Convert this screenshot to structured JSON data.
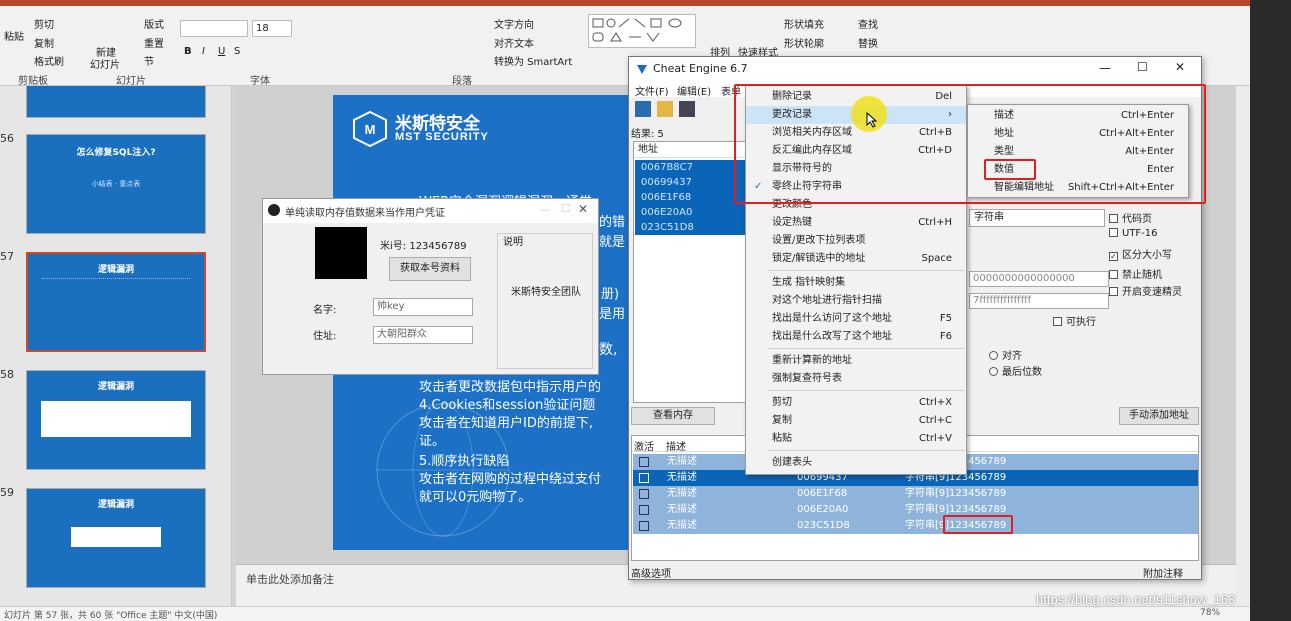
{
  "ribbon": {
    "clipboard": {
      "paste": "粘贴",
      "cut": "剪切",
      "copy": "复制",
      "painter": "格式刷",
      "group": "剪贴板"
    },
    "slides": {
      "new": "新建",
      "new2": "幻灯片",
      "layout": "版式",
      "reset": "重置",
      "section": "节",
      "group": "幻灯片"
    },
    "font": {
      "size": "18",
      "bold": "B",
      "italic": "I",
      "underline": "U",
      "shadow": "S",
      "group": "字体"
    },
    "paragraph": {
      "textdir": "文字方向",
      "align": "对齐文本",
      "smartart": "转换为 SmartArt",
      "group": "段落"
    },
    "drawing": {
      "arrange": "排列",
      "quickstyle": "快速样式",
      "fill": "形状填充",
      "outline": "形状轮廓",
      "effect": "形状效果"
    },
    "editing": {
      "find": "查找",
      "replace": "替换",
      "select": "选择"
    }
  },
  "thumbs": [
    {
      "num": "56",
      "title": "怎么修复SQL注入?",
      "sub": "小结表 · 重点表"
    },
    {
      "num": "57",
      "title": "逻辑漏洞",
      "selected": true
    },
    {
      "num": "58",
      "title": "逻辑漏洞"
    },
    {
      "num": "59",
      "title": "逻辑漏洞"
    }
  ],
  "slide": {
    "brand_cn": "米斯特安全",
    "brand_en": "MST SECURITY",
    "lines": [
      "WEB安全漏洞逻辑漏洞，通常",
      "的错",
      "就是",
      "册)",
      "是用",
      "数,",
      "攻击者更改数据包中指示用户的",
      "4.Cookies和session验证问题",
      "攻击者在知道用户ID的前提下,",
      "证。",
      "5.顺序执行缺陷",
      "攻击者在网购的过程中绕过支付",
      "就可以0元购物了。"
    ]
  },
  "notes": "单击此处添加备注",
  "status": {
    "left": "幻灯片 第 57 张，共 60 张    \"Office 主题\"    中文(中国)",
    "zoom": "78%"
  },
  "watermark": "https://blog.csdn.net/s11show_163",
  "app_window": {
    "title": "单纯读取内存值数据来当作用户凭证",
    "rice_label": "米i号: 123456789",
    "fetch_button": "获取本号资料",
    "desc_title": "说明",
    "desc_text": "米斯特安全团队",
    "name_label": "名字:",
    "name_value": "帅key",
    "addr_label": "住址:",
    "addr_value": "大朝阳群众"
  },
  "ce": {
    "title": "Cheat Engine 6.7",
    "menu": [
      "文件(F)",
      "编辑(E)",
      "表单"
    ],
    "found": "结果: 5",
    "col_addr": "地址",
    "col_cur": "当",
    "addresses": [
      "0067B8C7",
      "00699437",
      "006E1F68",
      "006E20A0",
      "023C51D8"
    ],
    "view_mem": "查看内存",
    "add_manual": "手动添加地址",
    "hex1": "0000000000000000",
    "hex2": "7fffffffffffffff",
    "writable": "可执行",
    "align": "对齐",
    "lastdigit": "最后位数",
    "opt_codepage": "代码页",
    "opt_utf16": "UTF-16",
    "opt_case": "区分大小写",
    "opt_norandom": "禁止随机",
    "opt_speedhack": "开启变速精灵",
    "type_sel": "字符串",
    "rec_headers": [
      "激活",
      "描述"
    ],
    "records": [
      {
        "desc": "无描述",
        "addr": "",
        "type": "",
        "val": "123456789"
      },
      {
        "desc": "无描述",
        "addr": "00699437",
        "type": "字符串[9]",
        "val": "123456789"
      },
      {
        "desc": "无描述",
        "addr": "006E1F68",
        "type": "字符串[9]",
        "val": "123456789"
      },
      {
        "desc": "无描述",
        "addr": "006E20A0",
        "type": "字符串[9]",
        "val": "123456789"
      },
      {
        "desc": "无描述",
        "addr": "023C51D8",
        "type": "字符串[9]",
        "val": "123456789"
      }
    ],
    "advanced": "高级选项",
    "attach": "附加注释"
  },
  "ctx_menu": [
    {
      "label": "删除记录",
      "sc": "Del"
    },
    {
      "label": "更改记录",
      "sc": "",
      "arrow": true,
      "hl": true
    },
    {
      "label": "浏览相关内存区域",
      "sc": "Ctrl+B"
    },
    {
      "label": "反汇编此内存区域",
      "sc": "Ctrl+D"
    },
    {
      "label": "显示带符号的",
      "sc": ""
    },
    {
      "label": "零终止符字符串",
      "sc": "",
      "check": true
    },
    {
      "label": "更改颜色",
      "sc": ""
    },
    {
      "label": "设定热键",
      "sc": "Ctrl+H"
    },
    {
      "label": "设置/更改下拉列表项",
      "sc": ""
    },
    {
      "label": "锁定/解锁选中的地址",
      "sc": "Space"
    },
    {
      "label": "生成 指针映射集",
      "sc": ""
    },
    {
      "label": "对这个地址进行指针扫描",
      "sc": ""
    },
    {
      "label": "找出是什么访问了这个地址",
      "sc": "F5"
    },
    {
      "label": "找出是什么改写了这个地址",
      "sc": "F6"
    },
    {
      "label": "重新计算新的地址",
      "sc": ""
    },
    {
      "label": "强制复查符号表",
      "sc": ""
    },
    {
      "label": "剪切",
      "sc": "Ctrl+X"
    },
    {
      "label": "复制",
      "sc": "Ctrl+C"
    },
    {
      "label": "粘贴",
      "sc": "Ctrl+V"
    },
    {
      "label": "创建表头",
      "sc": ""
    }
  ],
  "sub_menu": [
    {
      "label": "描述",
      "sc": "Ctrl+Enter"
    },
    {
      "label": "地址",
      "sc": "Ctrl+Alt+Enter"
    },
    {
      "label": "类型",
      "sc": "Alt+Enter"
    },
    {
      "label": "数值",
      "sc": "Enter"
    },
    {
      "label": "智能编辑地址",
      "sc": "Shift+Ctrl+Alt+Enter"
    }
  ],
  "colors": {
    "accent": "#1c70c6",
    "select": "#0a64b8",
    "highlight": "#cde4f7",
    "redbox": "#e0201c",
    "cursor": "#f0e000"
  }
}
